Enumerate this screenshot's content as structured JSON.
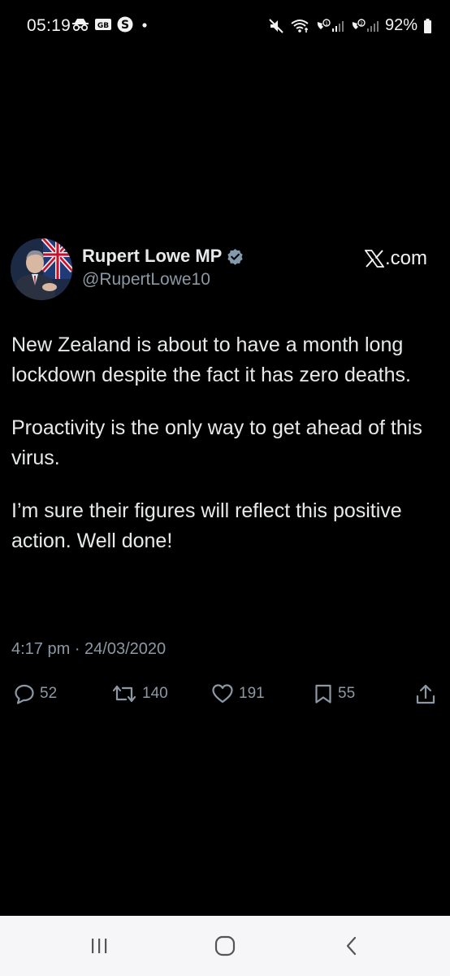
{
  "status_bar": {
    "time": "05:19",
    "left_icons": [
      "incognito-icon",
      "hd-icon",
      "skype-icon",
      "dot-icon"
    ],
    "right_icons": [
      "mute-icon",
      "wifi-call-icon",
      "signal-sim1-icon",
      "signal-sim2-icon"
    ],
    "battery": "92%"
  },
  "tweet": {
    "display_name": "Rupert Lowe MP",
    "verified": true,
    "handle": "@RupertLowe10",
    "source_label": ".com",
    "body": [
      "New Zealand is about to have a month long lockdown despite the fact it has zero deaths.",
      "Proactivity is the only way to get ahead of this virus.",
      "I’m sure their figures will reflect this positive action. Well done!"
    ],
    "timestamp": "4:17 pm · 24/03/2020",
    "actions": {
      "replies": "52",
      "retweets": "140",
      "likes": "191",
      "bookmarks": "55"
    }
  },
  "colors": {
    "background": "#000000",
    "text": "#e7e9ea",
    "muted": "#8b98a5",
    "verified_badge": "#829aab",
    "nav_bar": "#f6f6f8"
  },
  "nav_bar": {
    "buttons": [
      "recent-apps",
      "home",
      "back"
    ]
  }
}
